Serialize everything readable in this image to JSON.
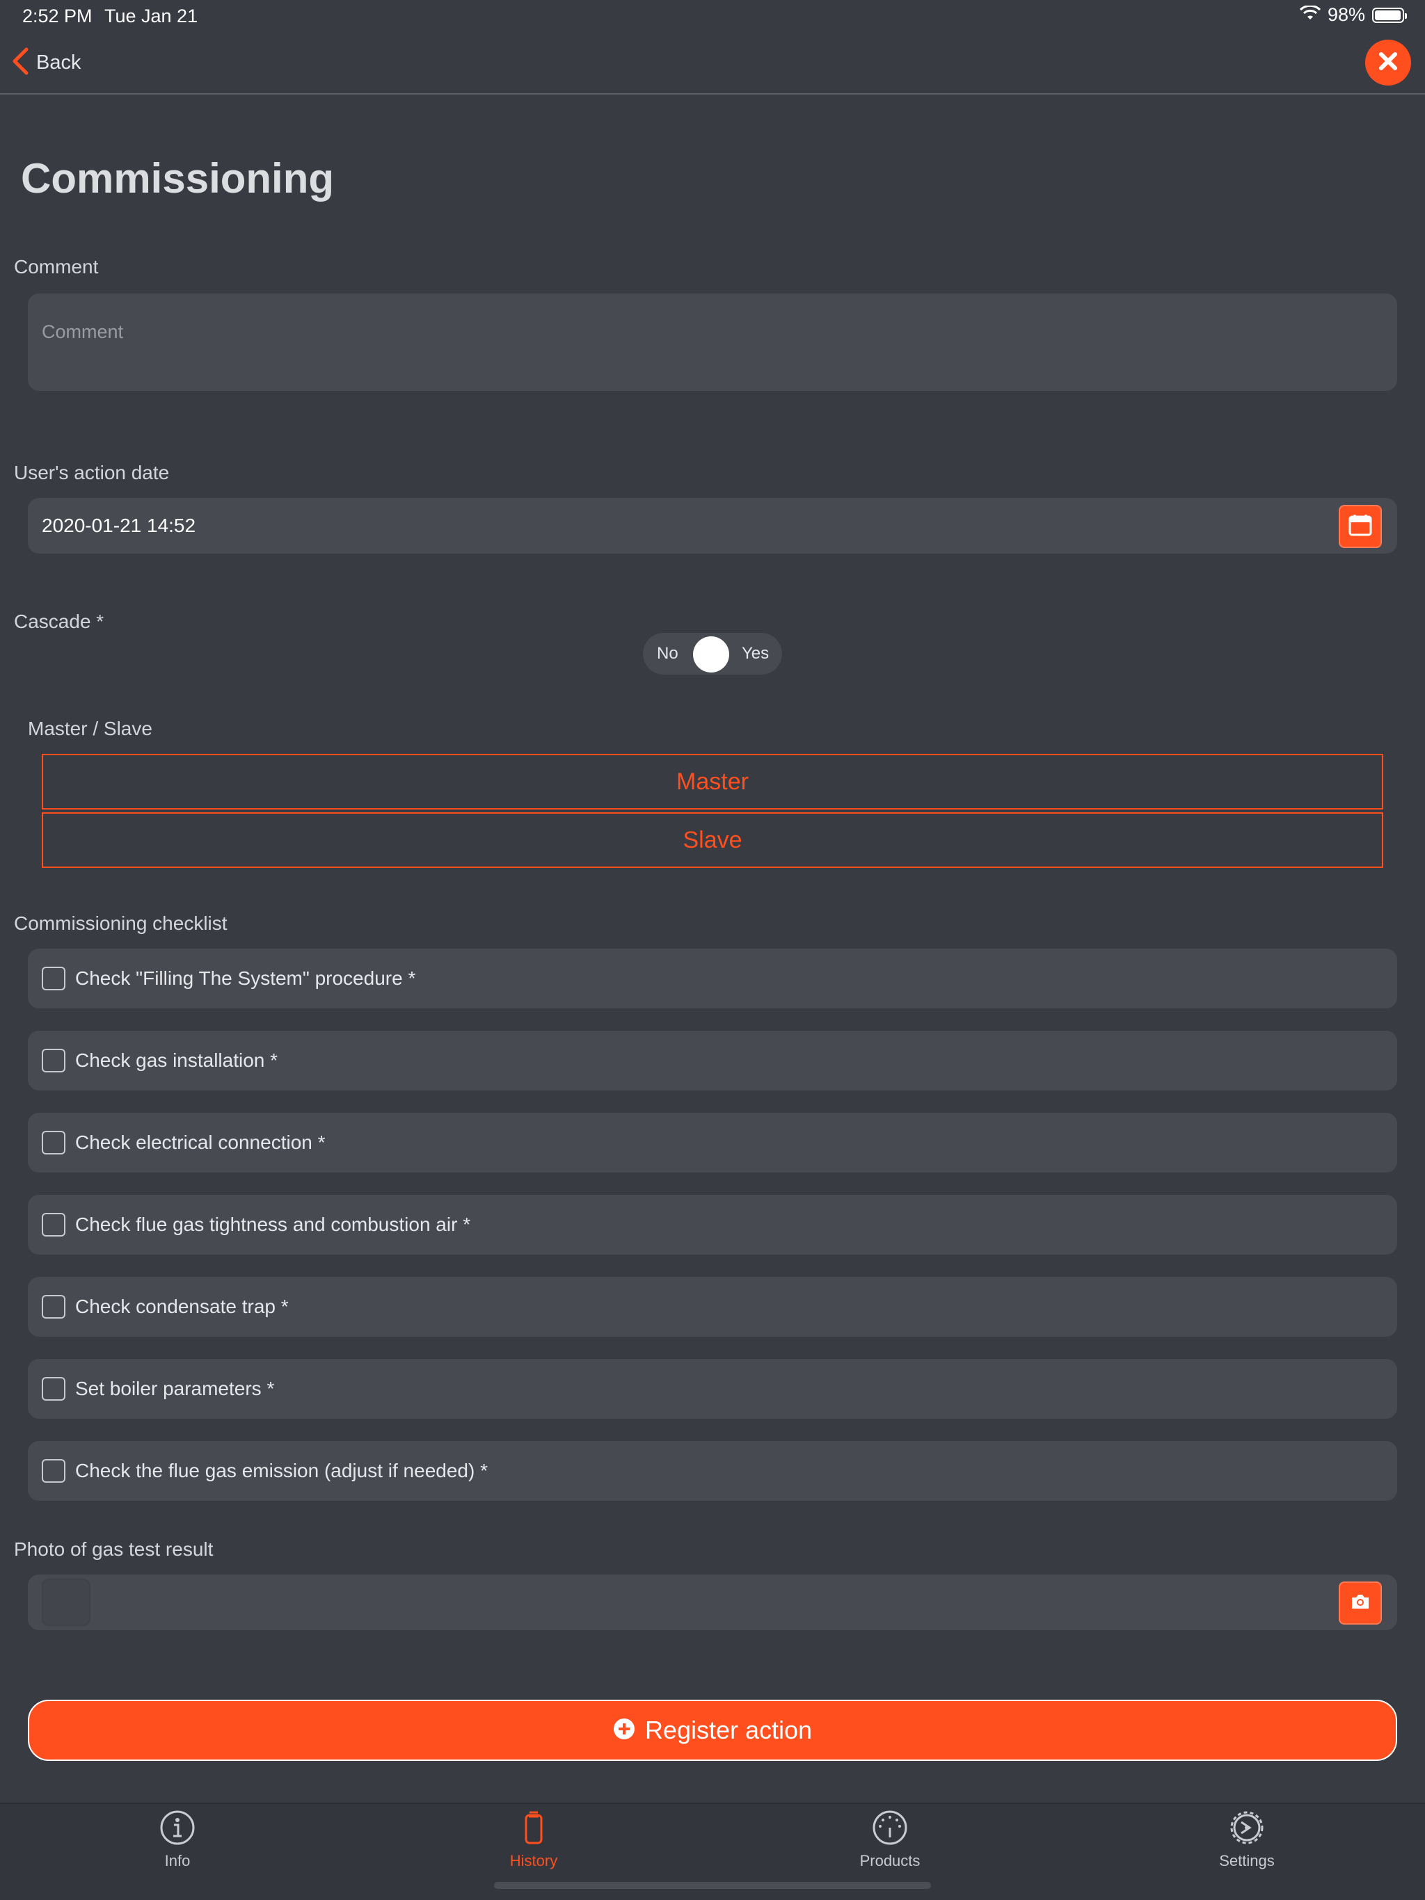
{
  "status_bar": {
    "time": "2:52 PM",
    "date": "Tue Jan 21",
    "battery": "98%",
    "battery_level": 0.98
  },
  "nav": {
    "back_label": "Back"
  },
  "page": {
    "title": "Commissioning"
  },
  "comment": {
    "label": "Comment",
    "placeholder": "Comment",
    "value": ""
  },
  "action_date": {
    "label": "User's action date",
    "value": "2020-01-21 14:52"
  },
  "cascade": {
    "label": "Cascade *",
    "off_label": "No",
    "on_label": "Yes",
    "value": false
  },
  "master_slave": {
    "label": "Master / Slave",
    "options": [
      "Master",
      "Slave"
    ]
  },
  "checklist": {
    "label": "Commissioning checklist",
    "items": [
      {
        "text": "Check \"Filling The System\" procedure *",
        "checked": false
      },
      {
        "text": "Check gas installation *",
        "checked": false
      },
      {
        "text": "Check electrical connection *",
        "checked": false
      },
      {
        "text": "Check flue gas tightness and combustion air *",
        "checked": false
      },
      {
        "text": "Check condensate trap *",
        "checked": false
      },
      {
        "text": "Set boiler parameters *",
        "checked": false
      },
      {
        "text": "Check the flue gas emission (adjust if needed) *",
        "checked": false
      }
    ]
  },
  "photo": {
    "label": "Photo of gas test result"
  },
  "register": {
    "label": "Register action"
  },
  "tabs": [
    {
      "label": "Info",
      "icon": "info-icon",
      "active": false
    },
    {
      "label": "History",
      "icon": "history-icon",
      "active": true
    },
    {
      "label": "Products",
      "icon": "products-icon",
      "active": false
    },
    {
      "label": "Settings",
      "icon": "settings-icon",
      "active": false
    }
  ],
  "colors": {
    "accent": "#ff4f1f",
    "background": "#383b42",
    "field": "#474a51"
  }
}
